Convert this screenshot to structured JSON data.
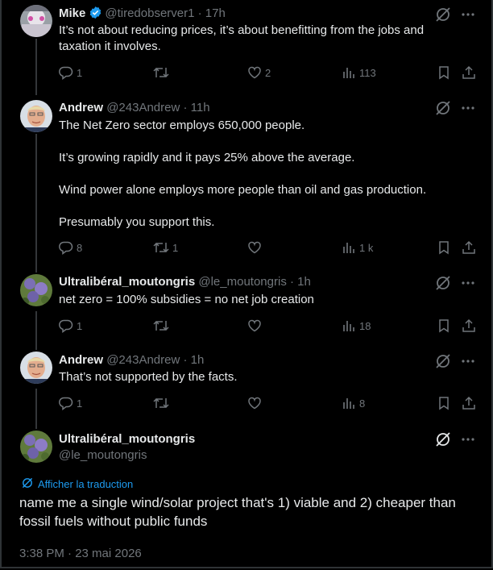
{
  "replies": [
    {
      "name": "Mike",
      "handle": "@tiredobserver1 · 17h",
      "text": "It’s not about reducing prices, it’s about benefitting from the jobs and taxation it involves.",
      "stats": {
        "replies": "1",
        "retweets": "",
        "likes": "2",
        "views": "113"
      }
    },
    {
      "name": "Andrew",
      "handle": "@243Andrew · 11h",
      "text": "The Net Zero sector employs 650,000 people.\n\nIt’s growing rapidly and it pays 25% above the average.\n\nWind power alone employs more people than oil and gas production.\n\nPresumably you support this.",
      "stats": {
        "replies": "8",
        "retweets": "1",
        "likes": "",
        "views": "1 k"
      }
    },
    {
      "name": "Ultralibéral_moutongris",
      "handle": "@le_moutongris · 1h",
      "text": "net zero = 100% subsidies = no net job creation",
      "stats": {
        "replies": "1",
        "retweets": "",
        "likes": "",
        "views": "18"
      }
    },
    {
      "name": "Andrew",
      "handle": "@243Andrew · 1h",
      "text": "That’s not supported by the facts.",
      "stats": {
        "replies": "1",
        "retweets": "",
        "likes": "",
        "views": "8"
      }
    }
  ],
  "main": {
    "name": "Ultralibéral_moutongris",
    "handle": "@le_moutongris",
    "translate_label": "Afficher la traduction",
    "text": "name me a single wind/solar project that's 1) viable and 2) cheaper than fossil fuels without public funds",
    "timestamp": "3:38 PM · 23 mai 2026"
  },
  "colors": {
    "background": "#000000",
    "text": "#e7e9ea",
    "muted": "#71767b",
    "link": "#1d9bf0",
    "verified": "#1d9bf0"
  }
}
